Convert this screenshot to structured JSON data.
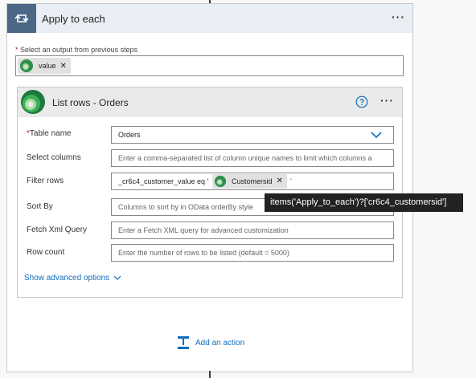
{
  "loop": {
    "title": "Apply to each",
    "output_label_required": "*",
    "output_label": " Select an output from previous steps",
    "value_token": "value"
  },
  "step": {
    "title": "List rows - Orders",
    "fields": {
      "table_name": {
        "required": "*",
        "label": "Table name",
        "value": "Orders"
      },
      "select_columns": {
        "label": "Select columns",
        "placeholder": "Enter a comma-separated list of column unique names to limit which columns a"
      },
      "filter_rows": {
        "label": "Filter rows",
        "prefix": "_cr6c4_customer_value eq '",
        "token": "Customersid",
        "suffix": "'"
      },
      "sort_by": {
        "label": "Sort By",
        "placeholder": "Columns to sort by in OData orderBy style"
      },
      "fetch_xml": {
        "label": "Fetch Xml Query",
        "placeholder": "Enter a Fetch XML query for advanced customization"
      },
      "row_count": {
        "label": "Row count",
        "placeholder": "Enter the number of rows to be listed (default = 5000)"
      }
    },
    "advanced_link": "Show advanced options"
  },
  "tooltip": "items('Apply_to_each')?['cr6c4_customersid']",
  "add_action": "Add an action",
  "icons": {
    "loop": "loop-arrows-icon",
    "dataverse": "dataverse-logo-icon",
    "help": "help-circle-icon",
    "more": "more-options-icon",
    "chevron": "chevron-down-icon",
    "add_action": "add-action-icon",
    "close": "close-icon"
  },
  "colors": {
    "loop_icon_bg": "#4a6785",
    "loop_header_bg": "#e9eef4",
    "link_blue": "#0f6cbd",
    "dataverse_green": "#2e8f4a",
    "required_red": "#a4262c",
    "tooltip_bg": "#222222"
  }
}
